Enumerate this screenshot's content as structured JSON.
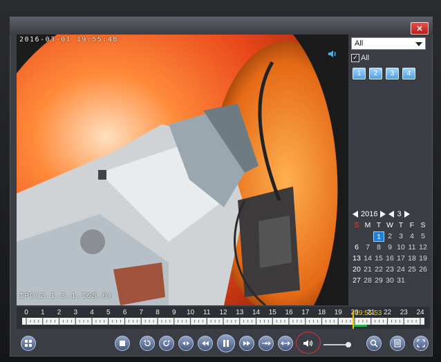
{
  "window": {
    "close_label": "×"
  },
  "video": {
    "timestamp": "2016-03-01 19:55:48",
    "camera_label": "IPC(2.1.3.1.168.0)"
  },
  "sidebar": {
    "select_value": "All",
    "all_checkbox_label": "All",
    "channels": [
      "1",
      "2",
      "3",
      "4"
    ]
  },
  "calendar": {
    "year": "2016",
    "month": "3",
    "weekday_headers": [
      "S",
      "M",
      "T",
      "W",
      "T",
      "F",
      "S"
    ],
    "leading_blanks": 2,
    "days": [
      "1",
      "2",
      "3",
      "4",
      "5",
      "6",
      "7",
      "8",
      "9",
      "10",
      "11",
      "12",
      "13",
      "14",
      "15",
      "16",
      "17",
      "18",
      "19",
      "20",
      "21",
      "22",
      "23",
      "24",
      "25",
      "26",
      "27",
      "28",
      "29",
      "30",
      "31"
    ],
    "selected_day": "1"
  },
  "timeline": {
    "hours": [
      "0",
      "1",
      "2",
      "3",
      "4",
      "5",
      "6",
      "7",
      "8",
      "9",
      "10",
      "11",
      "12",
      "13",
      "14",
      "15",
      "16",
      "17",
      "18",
      "19",
      "20",
      "21",
      "22",
      "23",
      "24"
    ],
    "cursor_time": "19:55:53",
    "cursor_hour": 19.93,
    "recording_start_hour": 19.9,
    "recording_end_hour": 20.75
  },
  "controls": {
    "volume_level": 0.9
  },
  "colors": {
    "accent": "#1e7fd8",
    "cursor": "#f0c400",
    "recording": "#21b14b",
    "close": "#d62a24",
    "highlight_ring": "#dd3333"
  }
}
